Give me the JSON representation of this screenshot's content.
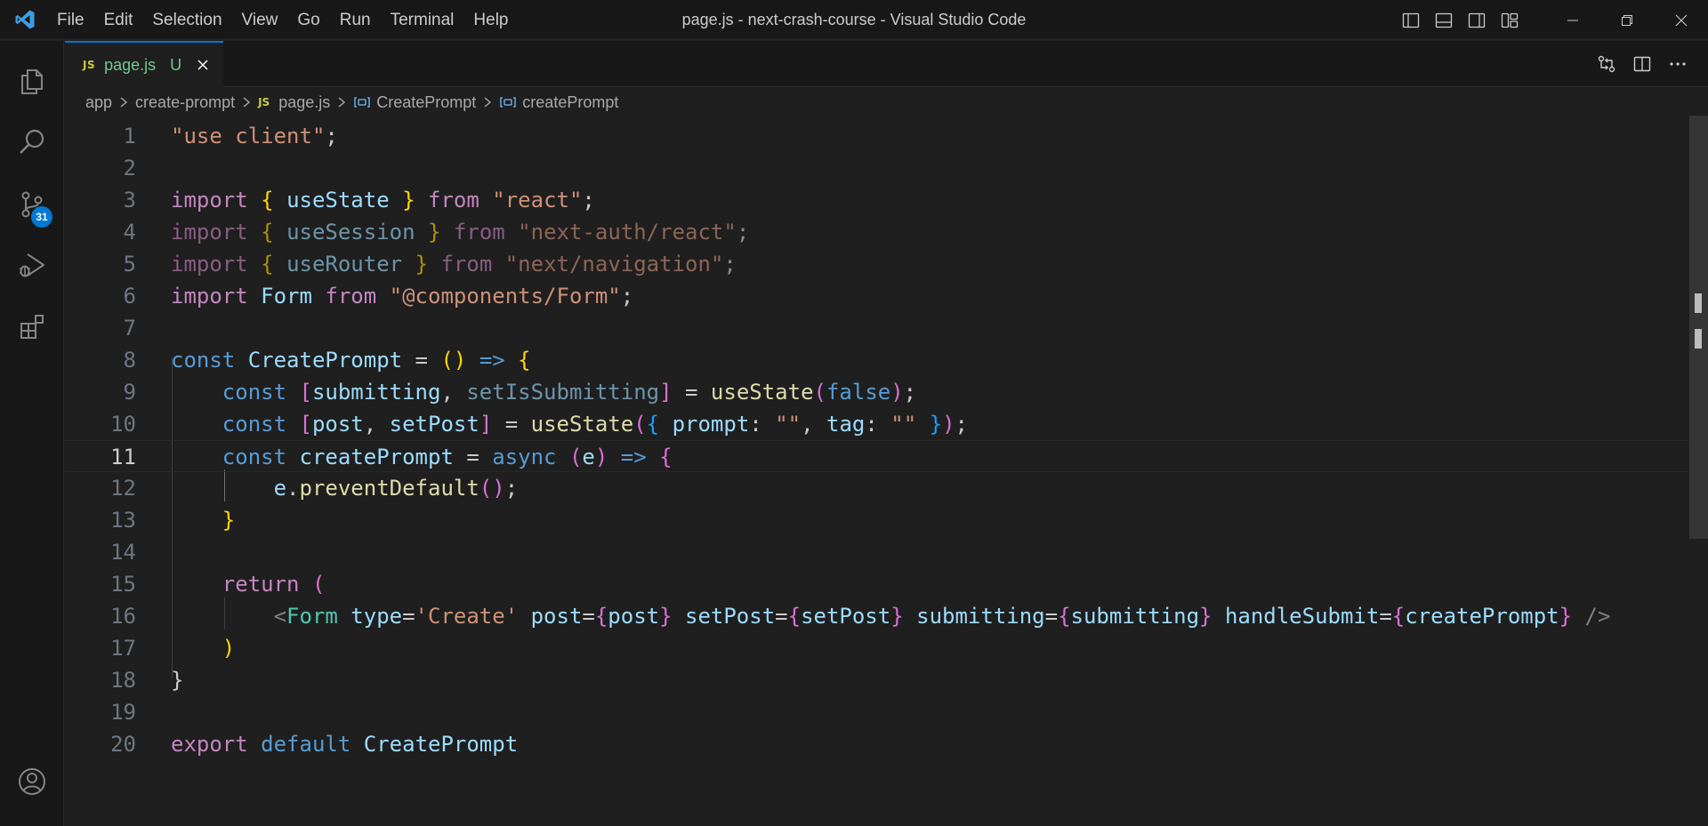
{
  "window": {
    "title": "page.js - next-crash-course - Visual Studio Code",
    "menu": [
      "File",
      "Edit",
      "Selection",
      "View",
      "Go",
      "Run",
      "Terminal",
      "Help"
    ]
  },
  "activity_bar": {
    "items": [
      {
        "name": "explorer",
        "icon": "files-icon"
      },
      {
        "name": "search",
        "icon": "search-icon"
      },
      {
        "name": "source-control",
        "icon": "source-control-icon",
        "badge": "31"
      },
      {
        "name": "run-and-debug",
        "icon": "debug-icon"
      },
      {
        "name": "extensions",
        "icon": "extensions-icon"
      },
      {
        "name": "accounts",
        "icon": "account-icon"
      }
    ]
  },
  "tab": {
    "type_badge": "JS",
    "name": "page.js",
    "status": "U"
  },
  "breadcrumb": {
    "items": [
      "app",
      "create-prompt",
      "page.js",
      "CreatePrompt",
      "createPrompt"
    ],
    "js_badge": "JS"
  },
  "editor": {
    "language": "javascript",
    "current_line": 11,
    "line_numbers": [
      "1",
      "2",
      "3",
      "4",
      "5",
      "6",
      "7",
      "8",
      "9",
      "10",
      "11",
      "12",
      "13",
      "14",
      "15",
      "16",
      "17",
      "18",
      "19",
      "20"
    ],
    "lines": [
      "\"use client\";",
      "",
      "import { useState } from \"react\";",
      "import { useSession } from \"next-auth/react\";",
      "import { useRouter } from \"next/navigation\";",
      "import Form from \"@components/Form\";",
      "",
      "const CreatePrompt = () => {",
      "    const [submitting, setIsSubmitting] = useState(false);",
      "    const [post, setPost] = useState({ prompt: \"\", tag: \"\" });",
      "    const createPrompt = async (e) => {",
      "        e.preventDefault();",
      "    }",
      "",
      "    return (",
      "        <Form type='Create' post={post} setPost={setPost} submitting={submitting} handleSubmit={createPrompt} />",
      "    )",
      "}",
      "",
      "export default CreatePrompt"
    ]
  },
  "colors": {
    "accent": "#0078d4",
    "untracked": "#73c991",
    "js_badge": "#cbcb41",
    "keyword": "#569cd6",
    "control_keyword": "#c586c0",
    "string": "#ce9178",
    "function": "#dcdcaa",
    "variable": "#9cdcfe"
  }
}
